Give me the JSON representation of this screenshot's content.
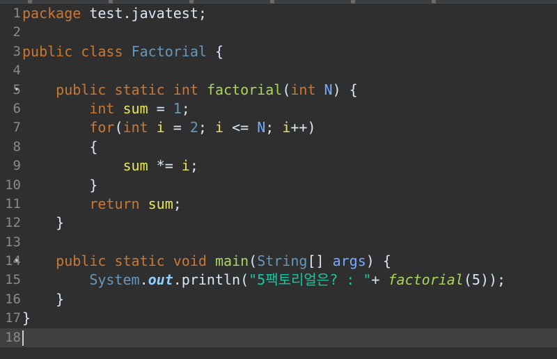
{
  "editor": {
    "language": "java",
    "line_numbers": [
      "1",
      "2",
      "3",
      "4",
      "5",
      "6",
      "7",
      "8",
      "9",
      "10",
      "11",
      "12",
      "13",
      "14",
      "15",
      "16",
      "17",
      "18"
    ],
    "fold_marker": "•",
    "lines": {
      "l1": {
        "package_kw": "package",
        "package_name": " test.javatest;"
      },
      "l3": {
        "public_kw": "public",
        "class_kw": "class",
        "class_name": "Factorial",
        "brace": " {"
      },
      "l5": {
        "public_kw": "public",
        "static_kw": "static",
        "int_kw": "int",
        "method_name": "factorial",
        "open": "(",
        "param_type": "int",
        "param": "N",
        "close": ") {"
      },
      "l6": {
        "int_kw": "int",
        "var": "sum",
        "op": " = ",
        "num": "1",
        "end": ";"
      },
      "l7": {
        "for_kw": "for",
        "open": "(",
        "int_kw": "int",
        "var1": "i",
        "op1": " = ",
        "num": "2",
        "sep1": "; ",
        "var2": "i",
        "op2": " <= ",
        "param": "N",
        "sep2": "; ",
        "var3": "i",
        "inc": "++)"
      },
      "l8": {
        "brace": "{"
      },
      "l9": {
        "var1": "sum",
        "op": " *= ",
        "var2": "i",
        "end": ";"
      },
      "l10": {
        "brace": "}"
      },
      "l11": {
        "return_kw": "return",
        "var": "sum",
        "end": ";"
      },
      "l12": {
        "brace": "}"
      },
      "l14": {
        "public_kw": "public",
        "static_kw": "static",
        "void_kw": "void",
        "method_name": "main",
        "open": "(",
        "type": "String",
        "arr": "[] ",
        "param": "args",
        "close": ") {"
      },
      "l15": {
        "sys": "System",
        "dot1": ".",
        "out": "out",
        "dot2": ".",
        "println": "println(",
        "str": "\"5팩토리얼은? : \"",
        "plus": "+ ",
        "call": "factorial",
        "args": "(5));"
      },
      "l16": {
        "brace": "}"
      },
      "l17": {
        "brace": "}"
      }
    }
  },
  "colors": {
    "background": "#2f2f2f",
    "current_line": "#404040",
    "keyword": "#cc7832",
    "class_name": "#6897bb",
    "method_decl": "#a9d65c",
    "local_var": "#e8e85a",
    "parameter": "#79abff",
    "string": "#17c6a3"
  }
}
